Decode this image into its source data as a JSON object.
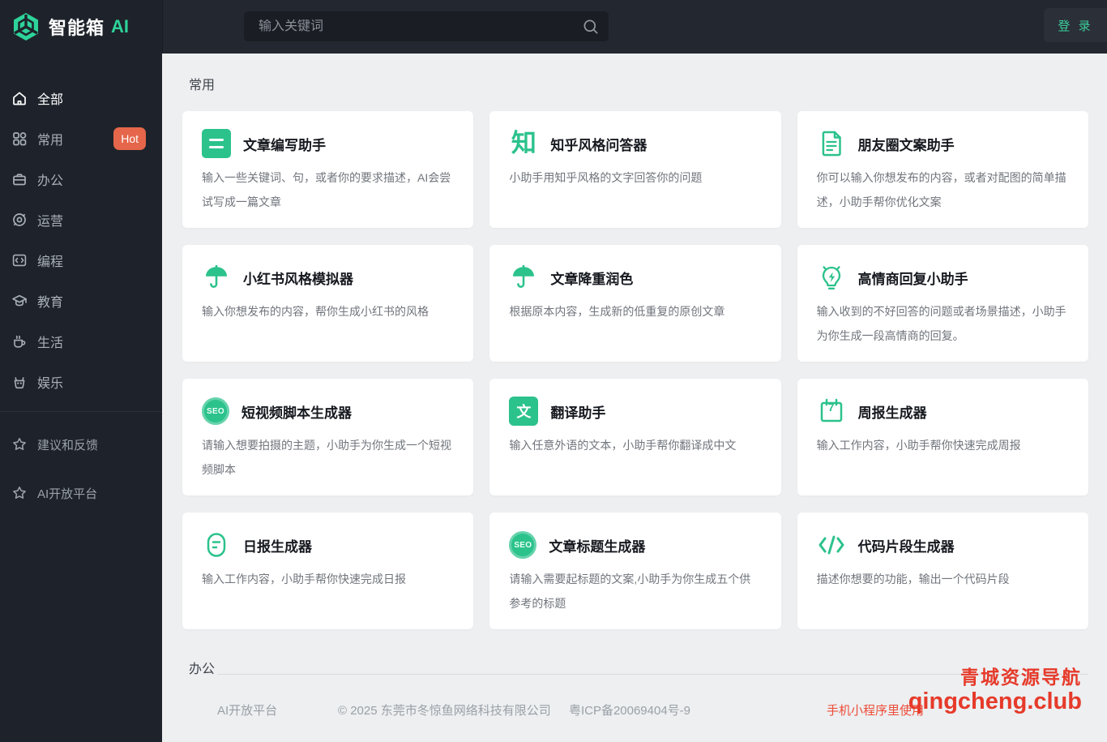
{
  "brand": {
    "name": "智能箱",
    "suffix": "AI",
    "logo_icon": "cube-icon"
  },
  "header": {
    "search_placeholder": "输入关键词",
    "search_icon": "search-icon",
    "login_label": "登 录"
  },
  "sidebar": {
    "items": [
      {
        "label": "全部",
        "icon": "home-icon",
        "active": true
      },
      {
        "label": "常用",
        "icon": "grid-icon",
        "badge": "Hot"
      },
      {
        "label": "办公",
        "icon": "briefcase-icon"
      },
      {
        "label": "运营",
        "icon": "operations-icon"
      },
      {
        "label": "编程",
        "icon": "code-icon"
      },
      {
        "label": "教育",
        "icon": "education-icon"
      },
      {
        "label": "生活",
        "icon": "coffee-icon"
      },
      {
        "label": "娱乐",
        "icon": "entertainment-icon"
      }
    ],
    "footer_items": [
      {
        "label": "建议和反馈",
        "icon": "star-icon"
      },
      {
        "label": "AI开放平台",
        "icon": "star-icon"
      }
    ]
  },
  "main": {
    "section_title": "常用",
    "next_section_title": "办公",
    "cards": [
      {
        "title": "文章编写助手",
        "desc": "输入一些关键词、句，或者你的要求描述，AI会尝试写成一篇文章",
        "icon": "list-icon"
      },
      {
        "title": "知乎风格问答器",
        "desc": "小助手用知乎风格的文字回答你的问题",
        "icon": "zhihu-icon",
        "icon_text": "知"
      },
      {
        "title": "朋友圈文案助手",
        "desc": "你可以输入你想发布的内容，或者对配图的简单描述，小助手帮你优化文案",
        "icon": "document-icon"
      },
      {
        "title": "小红书风格模拟器",
        "desc": "输入你想发布的内容，帮你生成小红书的风格",
        "icon": "umbrella-icon"
      },
      {
        "title": "文章降重润色",
        "desc": "根据原本内容，生成新的低重复的原创文章",
        "icon": "umbrella-icon"
      },
      {
        "title": "高情商回复小助手",
        "desc": "输入收到的不好回答的问题或者场景描述，小助手为你生成一段高情商的回复。",
        "icon": "bulb-icon"
      },
      {
        "title": "短视频脚本生成器",
        "desc": "请输入想要拍摄的主题，小助手为你生成一个短视频脚本",
        "icon": "seo-badge-icon",
        "icon_text": "SEO"
      },
      {
        "title": "翻译助手",
        "desc": "输入任意外语的文本，小助手帮你翻译成中文",
        "icon": "translate-icon",
        "icon_text": "文"
      },
      {
        "title": "周报生成器",
        "desc": "输入工作内容，小助手帮你快速完成周报",
        "icon": "calendar-icon",
        "icon_text": "7"
      },
      {
        "title": "日报生成器",
        "desc": "输入工作内容，小助手帮你快速完成日报",
        "icon": "note-icon"
      },
      {
        "title": "文章标题生成器",
        "desc": "请输入需要起标题的文案,小助手为你生成五个供参考的标题",
        "icon": "seo-badge-icon",
        "icon_text": "SEO"
      },
      {
        "title": "代码片段生成器",
        "desc": "描述你想要的功能，输出一个代码片段",
        "icon": "code-slash-icon"
      }
    ]
  },
  "footer": {
    "link": "AI开放平台",
    "copyright": "© 2025 东莞市冬惊鱼网络科技有限公司",
    "icp": "粤ICP备20069404号-9",
    "mini_program": "手机小程序里使用"
  },
  "watermark": {
    "line1": "青城资源导航",
    "line2": "qingcheng.club"
  },
  "colors": {
    "accent": "#2cc28c",
    "logo_green": "#2ed39a",
    "hot_badge": "#e5664a",
    "watermark_red": "#e63a2a",
    "sidebar_bg": "#1e232b",
    "header_bg": "#23272f",
    "content_bg": "#edeff1"
  }
}
